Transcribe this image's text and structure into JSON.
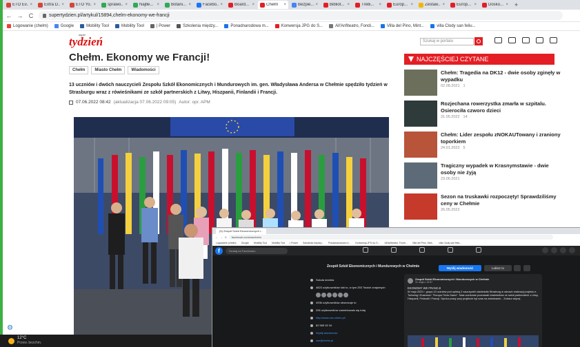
{
  "browser": {
    "tabs": [
      {
        "label": "ETO Ev...",
        "color": "#d44638"
      },
      {
        "label": "Extra D...",
        "color": "#d44638"
      },
      {
        "label": "ETO Yo...",
        "color": "#d44638"
      },
      {
        "label": "sprawo...",
        "color": "#34a853"
      },
      {
        "label": "Najtłe...",
        "color": "#34a853"
      },
      {
        "label": "Botani...",
        "color": "#34a853"
      },
      {
        "label": "Facebo...",
        "color": "#1877f2"
      },
      {
        "label": "Board...",
        "color": "#e31e24"
      },
      {
        "label": "Chełm",
        "color": "#e31e24",
        "active": true
      },
      {
        "label": "Bezpie...",
        "color": "#4285f4"
      },
      {
        "label": "Bibliot...",
        "color": "#e31e24"
      },
      {
        "label": "Trebi...",
        "color": "#e31e24"
      },
      {
        "label": "Europ...",
        "color": "#e31e24"
      },
      {
        "label": "Zestaw...",
        "color": "#f4b400"
      },
      {
        "label": "Europ...",
        "color": "#e31e24"
      },
      {
        "label": "Dosko...",
        "color": "#e31e24"
      }
    ],
    "tab_close": "×",
    "new_tab": "+",
    "url": "supertydzien.pl/artykul/15894,chelm-ekonomy-we-francji",
    "nav": {
      "back": "←",
      "forward": "→",
      "reload": "C"
    },
    "bookmarks": [
      {
        "label": "Logowanie (chełm)",
        "color": "#ea4335"
      },
      {
        "label": "Google",
        "color": "#4285f4"
      },
      {
        "label": "Mobility Tool",
        "color": "#2c5aa0"
      },
      {
        "label": "Mobility Tool",
        "color": "#2c5aa0"
      },
      {
        "label": "| Power",
        "color": "#666"
      },
      {
        "label": "Szkolenia między...",
        "color": "#555"
      },
      {
        "label": "Ponadnarodowa m...",
        "color": "#1a73e8"
      },
      {
        "label": "Konwersja JPG do S...",
        "color": "#e31e24"
      },
      {
        "label": "All'Anfiteatro, Fondi...",
        "color": "#777"
      },
      {
        "label": "Villa del Pino, Mint...",
        "color": "#1a73e8"
      },
      {
        "label": "villa Clody san feliu...",
        "color": "#1a73e8"
      }
    ]
  },
  "site": {
    "logo_sup": "super",
    "logo": "tydzień",
    "search_placeholder": "Szukaj w portalu"
  },
  "article": {
    "title": "Chełm. Ekonomy we Francji!",
    "tags": [
      "Chełm",
      "Miasto Chełm",
      "Wiadomości"
    ],
    "lead": "13 uczniów i dwóch nauczycieli Zespołu Szkół Ekonomicznych i Mundurowych im. gen. Władysława Andersa w Chełmie spędziło tydzień w Strasburgu wraz z rówieśnikami ze szkół partnerskich z Litwy, Hiszpanii, Finlandii i Francji.",
    "date": "07.06.2022 08:42",
    "updated": "(aktualizacja 07.06.2022 09:05)",
    "author": "Autor: opr. APM"
  },
  "sidebar": {
    "heading": "NAJCZĘŚCIEJ CZYTANE",
    "items": [
      {
        "title": "Chełm: Tragedia na DK12 - dwie osoby zginęły w wypadku",
        "date": "02.08.2021",
        "comments": "1",
        "thumb": "#6b6f5c"
      },
      {
        "title": "Rozjechana rowerzystka zmarła w szpitalu. Osierociła czworo dzieci",
        "date": "31.05.2022",
        "comments": "14",
        "thumb": "#2f3a3a"
      },
      {
        "title": "Chełm: Lider zespołu zNOKAUTowany i zraniony toporkiem",
        "date": "24.01.2022",
        "comments": "5",
        "thumb": "#b8543a"
      },
      {
        "title": "Tragiczny wypadek w Krasnymstawie - dwie osoby nie żyją",
        "date": "23.06.2021",
        "comments": "",
        "thumb": "#5d6b78"
      },
      {
        "title": "Sezon na truskawki rozpoczęty! Sprawdziliśmy ceny w Chełmie",
        "date": "26.05.2022",
        "comments": "",
        "thumb": "#c53a2a"
      }
    ]
  },
  "taskbar": {
    "temp": "12°C",
    "weather": "Przew. bezchm."
  },
  "facebook": {
    "tab": "(5) Zespół Szkół Ekonomicznych i...",
    "url": "facebook.com/zsechelm",
    "bookmarks": [
      "Logowanie (chełm)",
      "Google",
      "Mobility Tool",
      "Mobility Tool",
      "| Power",
      "Szkolenia między...",
      "Ponadnarodowa m...",
      "Konwersja JPG do S...",
      "All'Anfiteatro, Fondi...",
      "Villa del Pino, Mint...",
      "villa Clody san feliu..."
    ],
    "search_placeholder": "Szukaj na Facebooku",
    "page_name": "Zespół Szkół Ekonomicznych i Mundurowych w Chełmie",
    "message_button": "Wyślij wiadomość",
    "like_button": "Lubisz to",
    "info": [
      {
        "text": "Szkoła średnia",
        "style": ""
      },
      {
        "text": "4823 użytkowników lubi to, w tym 253 Twoich znajomych",
        "style": ""
      },
      {
        "text": "",
        "style": "avatars"
      },
      {
        "text": "4936 użytkowników obserwuje to",
        "style": ""
      },
      {
        "text": "206 użytkowników zameldowało się tutaj",
        "style": ""
      },
      {
        "text": "http://www.zse.chelm.pl/",
        "style": "link"
      },
      {
        "text": "82 565 52 34",
        "style": ""
      },
      {
        "text": "Wyślij wiadomość",
        "style": "link"
      },
      {
        "text": "zse@chelm.pl",
        "style": "link"
      },
      {
        "text": "Zamknięte teraz",
        "style": "red"
      }
    ],
    "post": {
      "author": "Zespół Szkół Ekonomicznych i Mundurowych w Chełmie",
      "date": "31 maja o 19:57",
      "title": "EKONOMY WE FRANCJI",
      "body": "W maju 2022 r. grupa 13 uczniów pod opieką 2 nauczycieli odwiedziła Strasburg w ramach realizacji projektu e-Twinning i Erasmus+ \"Europa Trivia Game\". Nasi uczniowie poznawali rówieśników ze szkół partnerskich z Litwy, Hiszpanii, Finlandii i Francji. Oprócz pracy przy projekcie był czas na zwiedzanie... Zobacz więcej"
    }
  }
}
